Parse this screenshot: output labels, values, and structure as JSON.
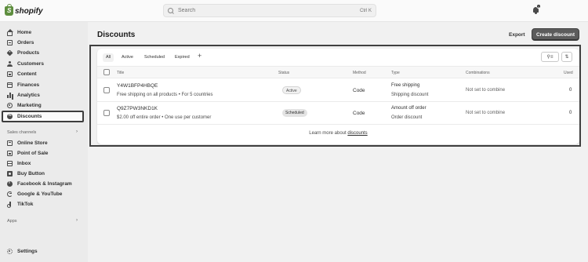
{
  "brand": {
    "logo_text": "shopify"
  },
  "search": {
    "placeholder": "Search",
    "shortcut": "Ctrl K"
  },
  "notifications": {
    "count": "1"
  },
  "sidebar": {
    "items": [
      {
        "label": "Home",
        "icon": "home-icon"
      },
      {
        "label": "Orders",
        "icon": "orders-icon"
      },
      {
        "label": "Products",
        "icon": "tag-icon"
      },
      {
        "label": "Customers",
        "icon": "person-icon"
      },
      {
        "label": "Content",
        "icon": "image-icon"
      },
      {
        "label": "Finances",
        "icon": "bank-icon"
      },
      {
        "label": "Analytics",
        "icon": "chart-icon"
      },
      {
        "label": "Marketing",
        "icon": "target-icon"
      },
      {
        "label": "Discounts",
        "icon": "discount-icon",
        "active": true
      }
    ],
    "sales_channels_label": "Sales channels",
    "channels": [
      {
        "label": "Online Store",
        "icon": "store-icon"
      },
      {
        "label": "Point of Sale",
        "icon": "pos-icon"
      },
      {
        "label": "Inbox",
        "icon": "inbox-icon"
      },
      {
        "label": "Buy Button",
        "icon": "buy-button-icon"
      },
      {
        "label": "Facebook & Instagram",
        "icon": "facebook-icon"
      },
      {
        "label": "Google & YouTube",
        "icon": "google-icon"
      },
      {
        "label": "TikTok",
        "icon": "tiktok-icon"
      }
    ],
    "apps_label": "Apps",
    "settings_label": "Settings",
    "chevron": "›"
  },
  "page": {
    "title": "Discounts",
    "export_label": "Export",
    "create_label": "Create discount"
  },
  "tabs": [
    "All",
    "Active",
    "Scheduled",
    "Expired"
  ],
  "tab_add": "+",
  "table": {
    "headers": {
      "title": "Title",
      "status": "Status",
      "method": "Method",
      "type": "Type",
      "combinations": "Combinations",
      "used": "Used"
    },
    "rows": [
      {
        "code": "Y4W1BFP4HBQE",
        "summary": "Free shipping on all products • For 5 countries",
        "status": "Active",
        "method": "Code",
        "type_main": "Free shipping",
        "type_sub": "Shipping discount",
        "combinations": "Not set to combine",
        "used": "0"
      },
      {
        "code": "Q9Z7PW3NKD1K",
        "summary": "$2.00 off entire order • One use per customer",
        "status": "Scheduled",
        "method": "Code",
        "type_main": "Amount off order",
        "type_sub": "Order discount",
        "combinations": "Not set to combine",
        "used": "0"
      }
    ]
  },
  "footer": {
    "learn_prefix": "Learn more about ",
    "learn_link": "discounts"
  },
  "colors": {
    "brand_green": "#5e8e3e",
    "primary_button": "#5c5c5c",
    "sidebar_bg": "#ebebeb",
    "page_bg": "#f1f1f1"
  }
}
